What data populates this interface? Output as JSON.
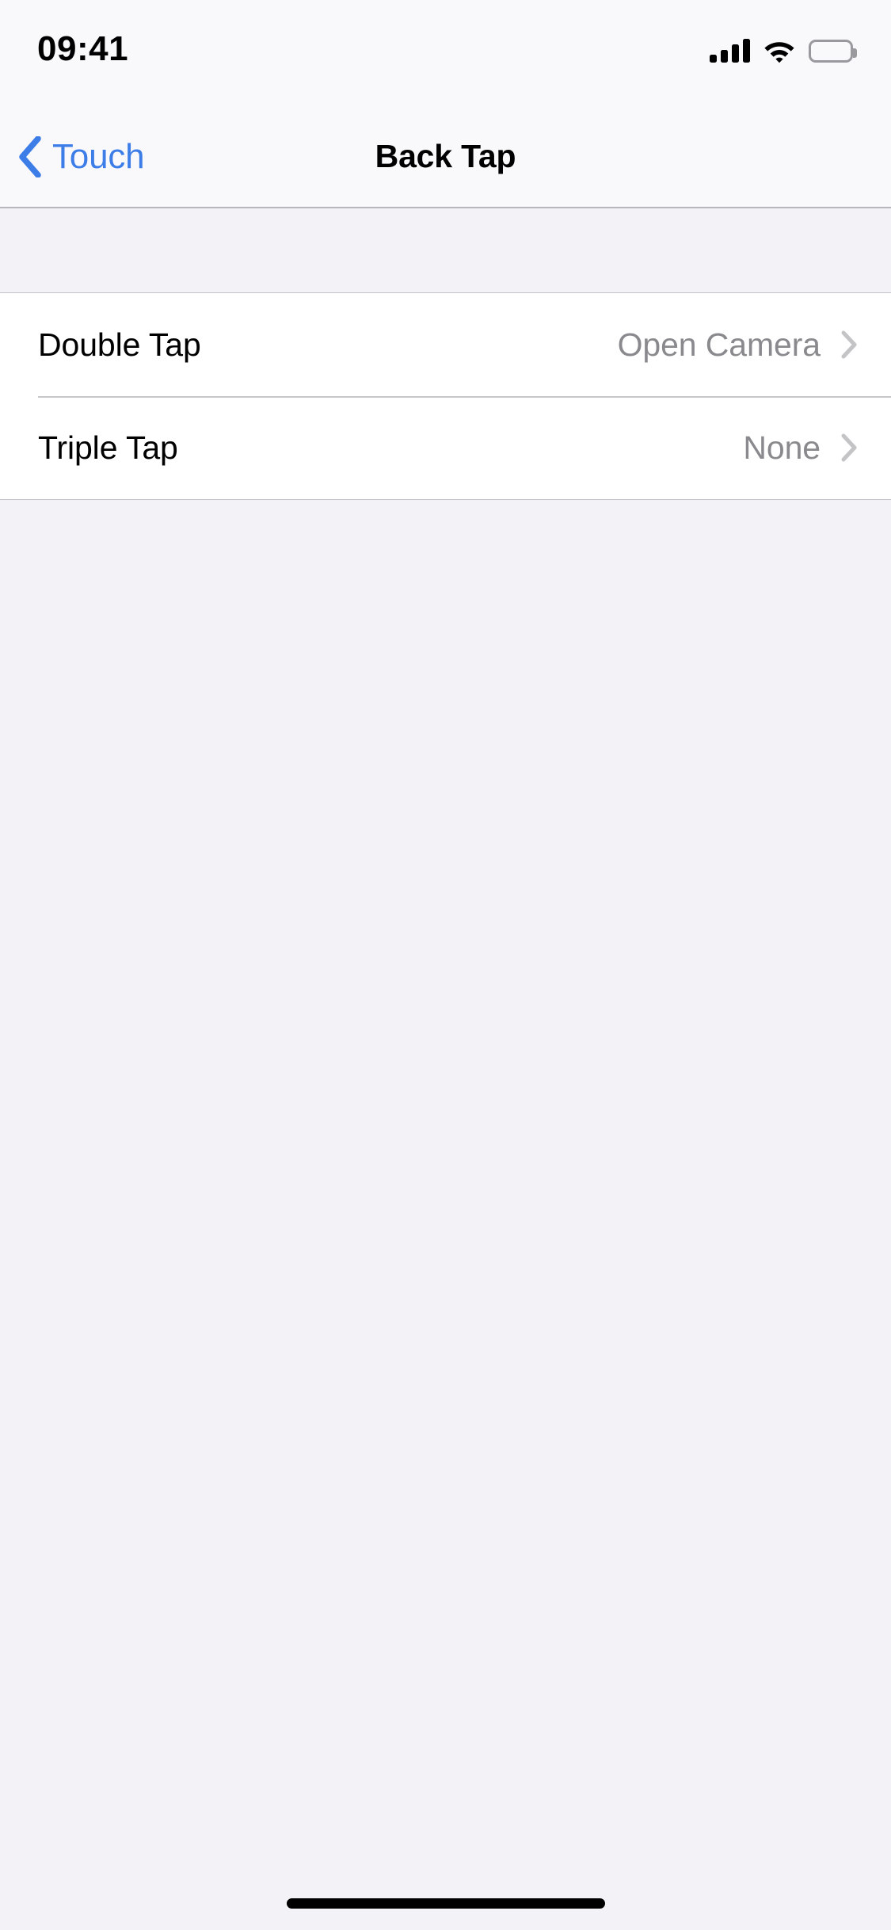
{
  "status_bar": {
    "time": "09:41",
    "cellular_icon": "cellular-signal-icon",
    "cellular_bars_filled": 4,
    "cellular_bars_total": 4,
    "wifi_icon": "wifi-icon",
    "battery_icon": "battery-icon",
    "battery_full": true
  },
  "nav_bar": {
    "back_icon": "chevron-left-icon",
    "back_label": "Touch",
    "title": "Back Tap"
  },
  "colors": {
    "accent_blue": "#3C7DE8",
    "value_gray": "#8A8A8E",
    "chevron_gray": "#C4C4C7",
    "group_background": "#F2F2F7",
    "cell_background": "#FFFFFF",
    "separator": "#C6C6C8"
  },
  "settings_list": {
    "rows": [
      {
        "label": "Double Tap",
        "value": "Open Camera",
        "accessory_icon": "chevron-right-icon"
      },
      {
        "label": "Triple Tap",
        "value": "None",
        "accessory_icon": "chevron-right-icon"
      }
    ]
  },
  "home_indicator": {
    "name": "home-indicator"
  }
}
